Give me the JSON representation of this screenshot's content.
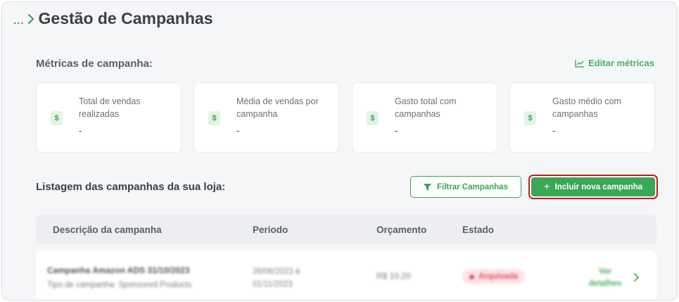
{
  "header": {
    "dots": "...",
    "title": "Gestão de Campanhas"
  },
  "metrics": {
    "section_title": "Métricas de campanha:",
    "edit_label": "Editar métricas",
    "cards": [
      {
        "icon": "dollar-icon",
        "icon_text": "$",
        "label": "Total de vendas realizadas",
        "value": "-"
      },
      {
        "icon": "dollar-icon",
        "icon_text": "$",
        "label": "Média de vendas por campanha",
        "value": "-"
      },
      {
        "icon": "dollar-icon",
        "icon_text": "$",
        "label": "Gasto total com campanhas",
        "value": "-"
      },
      {
        "icon": "dollar-icon",
        "icon_text": "$",
        "label": "Gasto médio com campanhas",
        "value": "-"
      }
    ]
  },
  "listing": {
    "section_title": "Listagem das campanhas da sua loja:",
    "filter_label": "Filtrar Campanhas",
    "add_label": "Incluir nova campanha",
    "columns": [
      "Descrição da campanha",
      "Periodo",
      "Orçamento",
      "Estado"
    ],
    "rows": [
      {
        "name": "Campanha Amazon ADS 31/10/2023",
        "type": "Tipo de campanha: Sponsored Products",
        "period": "26/06/2023 à 01/11/2023",
        "budget": "R$ 10,20",
        "status": "Arquivada",
        "details": "Ver detalhes"
      }
    ]
  },
  "colors": {
    "accent": "#3aa757",
    "highlight_border": "#c8191e",
    "status_archived": "#e25561"
  }
}
